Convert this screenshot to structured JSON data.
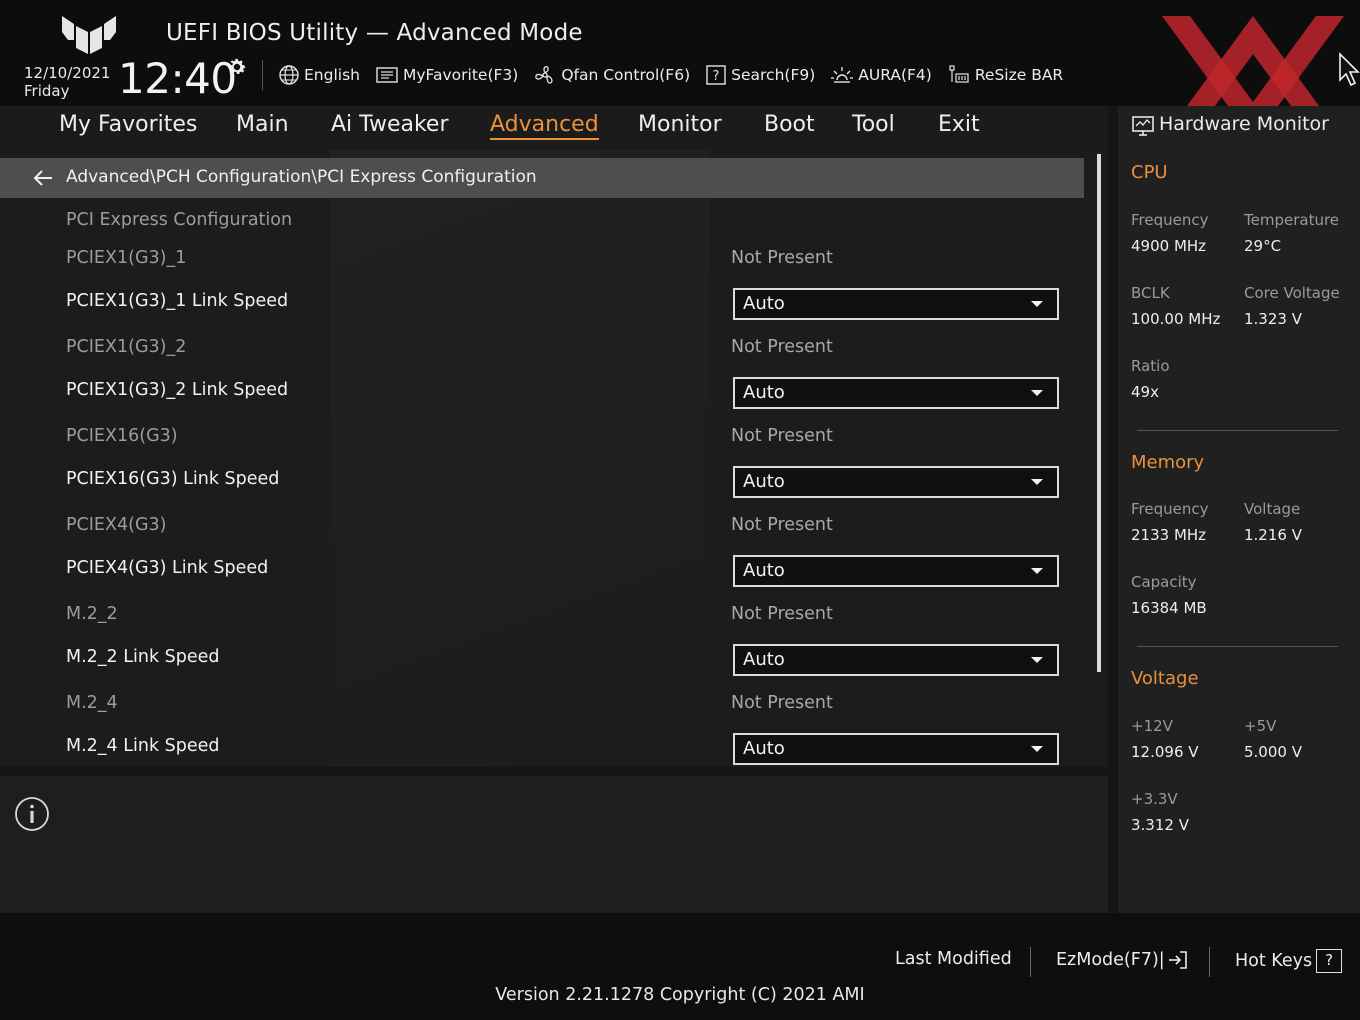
{
  "header": {
    "title": "UEFI BIOS Utility — Advanced Mode",
    "date": "12/10/2021",
    "day": "Friday",
    "time": "12:40",
    "toolbar": [
      {
        "label": "English",
        "icon": "globe-icon"
      },
      {
        "label": "MyFavorite(F3)",
        "icon": "favorite-icon"
      },
      {
        "label": "Qfan Control(F6)",
        "icon": "fan-icon"
      },
      {
        "label": "Search(F9)",
        "icon": "search-help-icon"
      },
      {
        "label": "AURA(F4)",
        "icon": "aura-light-icon"
      },
      {
        "label": "ReSize BAR",
        "icon": "resize-bar-icon"
      }
    ]
  },
  "nav": {
    "tabs": [
      "My Favorites",
      "Main",
      "Ai Tweaker",
      "Advanced",
      "Monitor",
      "Boot",
      "Tool",
      "Exit"
    ],
    "active": "Advanced"
  },
  "main": {
    "breadcrumb": "Advanced\\PCH Configuration\\PCI Express Configuration",
    "section_title": "PCI Express Configuration",
    "rows": [
      {
        "label": "PCIEX1(G3)_1",
        "value": "Not Present"
      },
      {
        "label": "PCIEX1(G3)_1 Link Speed",
        "dropdown": "Auto"
      },
      {
        "label": "PCIEX1(G3)_2",
        "value": "Not Present"
      },
      {
        "label": "PCIEX1(G3)_2 Link Speed",
        "dropdown": "Auto"
      },
      {
        "label": "PCIEX16(G3)",
        "value": "Not Present"
      },
      {
        "label": "PCIEX16(G3) Link Speed",
        "dropdown": "Auto"
      },
      {
        "label": "PCIEX4(G3)",
        "value": "Not Present"
      },
      {
        "label": "PCIEX4(G3) Link Speed",
        "dropdown": "Auto"
      },
      {
        "label": "M.2_2",
        "value": "Not Present"
      },
      {
        "label": "M.2_2 Link Speed",
        "dropdown": "Auto"
      },
      {
        "label": "M.2_4",
        "value": "Not Present"
      },
      {
        "label": "M.2_4 Link Speed",
        "dropdown": "Auto"
      }
    ]
  },
  "hw_monitor": {
    "title": "Hardware Monitor",
    "cpu": {
      "heading": "CPU",
      "frequency_label": "Frequency",
      "frequency": "4900 MHz",
      "temperature_label": "Temperature",
      "temperature": "29°C",
      "bclk_label": "BCLK",
      "bclk": "100.00 MHz",
      "core_voltage_label": "Core Voltage",
      "core_voltage": "1.323 V",
      "ratio_label": "Ratio",
      "ratio": "49x"
    },
    "memory": {
      "heading": "Memory",
      "frequency_label": "Frequency",
      "frequency": "2133 MHz",
      "voltage_label": "Voltage",
      "voltage": "1.216 V",
      "capacity_label": "Capacity",
      "capacity": "16384 MB"
    },
    "voltage": {
      "heading": "Voltage",
      "v12_label": "+12V",
      "v12": "12.096 V",
      "v5_label": "+5V",
      "v5": "5.000 V",
      "v33_label": "+3.3V",
      "v33": "3.312 V"
    }
  },
  "footer": {
    "last_modified": "Last Modified",
    "ezmode": "EzMode(F7)|",
    "hot_keys": "Hot Keys",
    "hot_keys_glyph": "?",
    "version": "Version 2.21.1278 Copyright (C) 2021 AMI"
  },
  "colors": {
    "accent": "#e8913c",
    "watermark": "#c0272d"
  }
}
